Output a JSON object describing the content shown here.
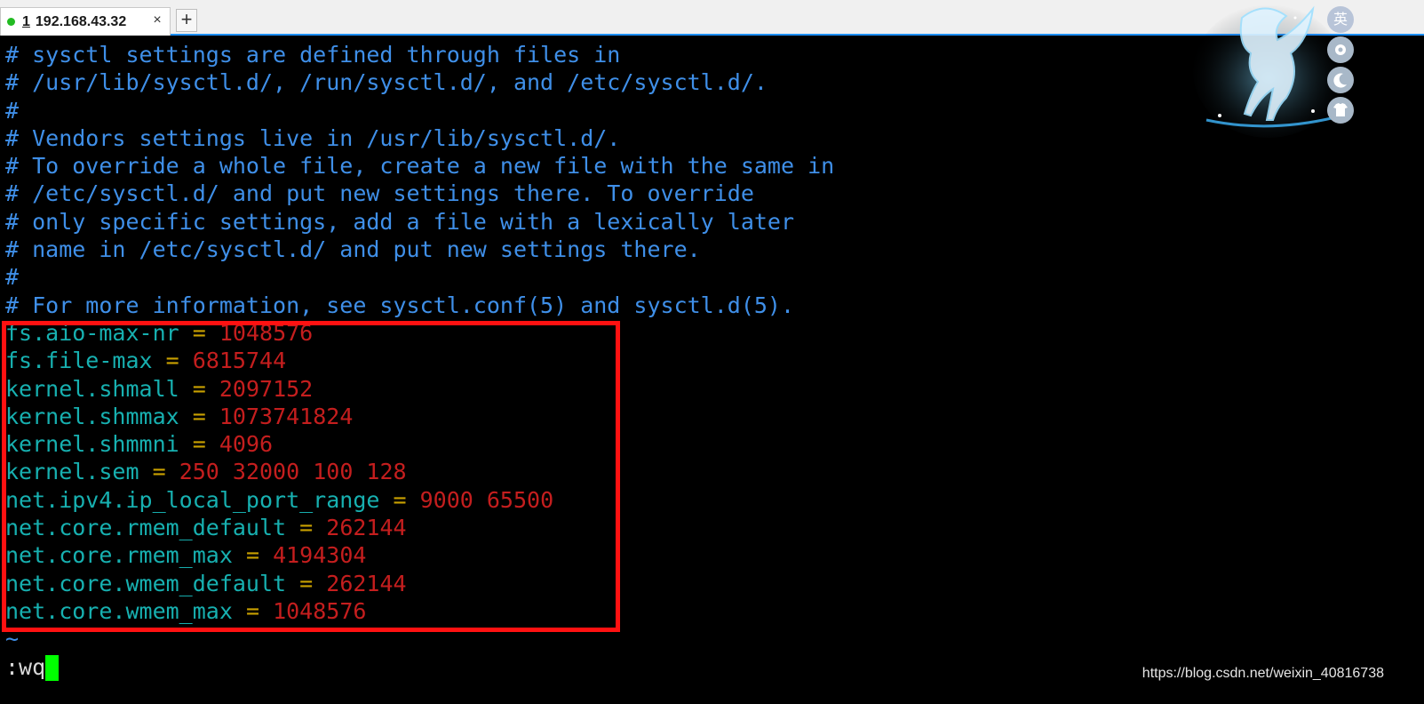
{
  "tab": {
    "number": "1",
    "title": "192.168.43.32",
    "close_glyph": "×",
    "status_color": "#22bb22"
  },
  "new_tab_glyph": "+",
  "comments": [
    "# sysctl settings are defined through files in",
    "# /usr/lib/sysctl.d/, /run/sysctl.d/, and /etc/sysctl.d/.",
    "#",
    "# Vendors settings live in /usr/lib/sysctl.d/.",
    "# To override a whole file, create a new file with the same in",
    "# /etc/sysctl.d/ and put new settings there. To override",
    "# only specific settings, add a file with a lexically later",
    "# name in /etc/sysctl.d/ and put new settings there.",
    "#",
    "# For more information, see sysctl.conf(5) and sysctl.d(5)."
  ],
  "settings": [
    {
      "key": "fs.aio-max-nr",
      "value": "1048576"
    },
    {
      "key": "fs.file-max",
      "value": "6815744"
    },
    {
      "key": "kernel.shmall",
      "value": "2097152"
    },
    {
      "key": "kernel.shmmax",
      "value": "1073741824"
    },
    {
      "key": "kernel.shmmni",
      "value": "4096"
    },
    {
      "key": "kernel.sem",
      "value": "250 32000 100 128"
    },
    {
      "key": "net.ipv4.ip_local_port_range",
      "value": "9000 65500"
    },
    {
      "key": "net.core.rmem_default",
      "value": "262144"
    },
    {
      "key": "net.core.rmem_max",
      "value": "4194304"
    },
    {
      "key": "net.core.wmem_default",
      "value": "262144"
    },
    {
      "key": "net.core.wmem_max",
      "value": "1048576"
    }
  ],
  "equals": "=",
  "tilde": "~",
  "command": ":wq",
  "watermark": "https://blog.csdn.net/weixin_40816738",
  "ime": {
    "language": "英",
    "buttons": [
      "settings-icon",
      "moon-icon",
      "shirt-icon"
    ]
  },
  "colors": {
    "comment": "#3f8fe8",
    "key": "#17b0b0",
    "equals": "#c8a000",
    "value": "#c41e1e",
    "highlight": "#ff1111",
    "cursor": "#00ff00",
    "tab_underline": "#1e90ff"
  }
}
